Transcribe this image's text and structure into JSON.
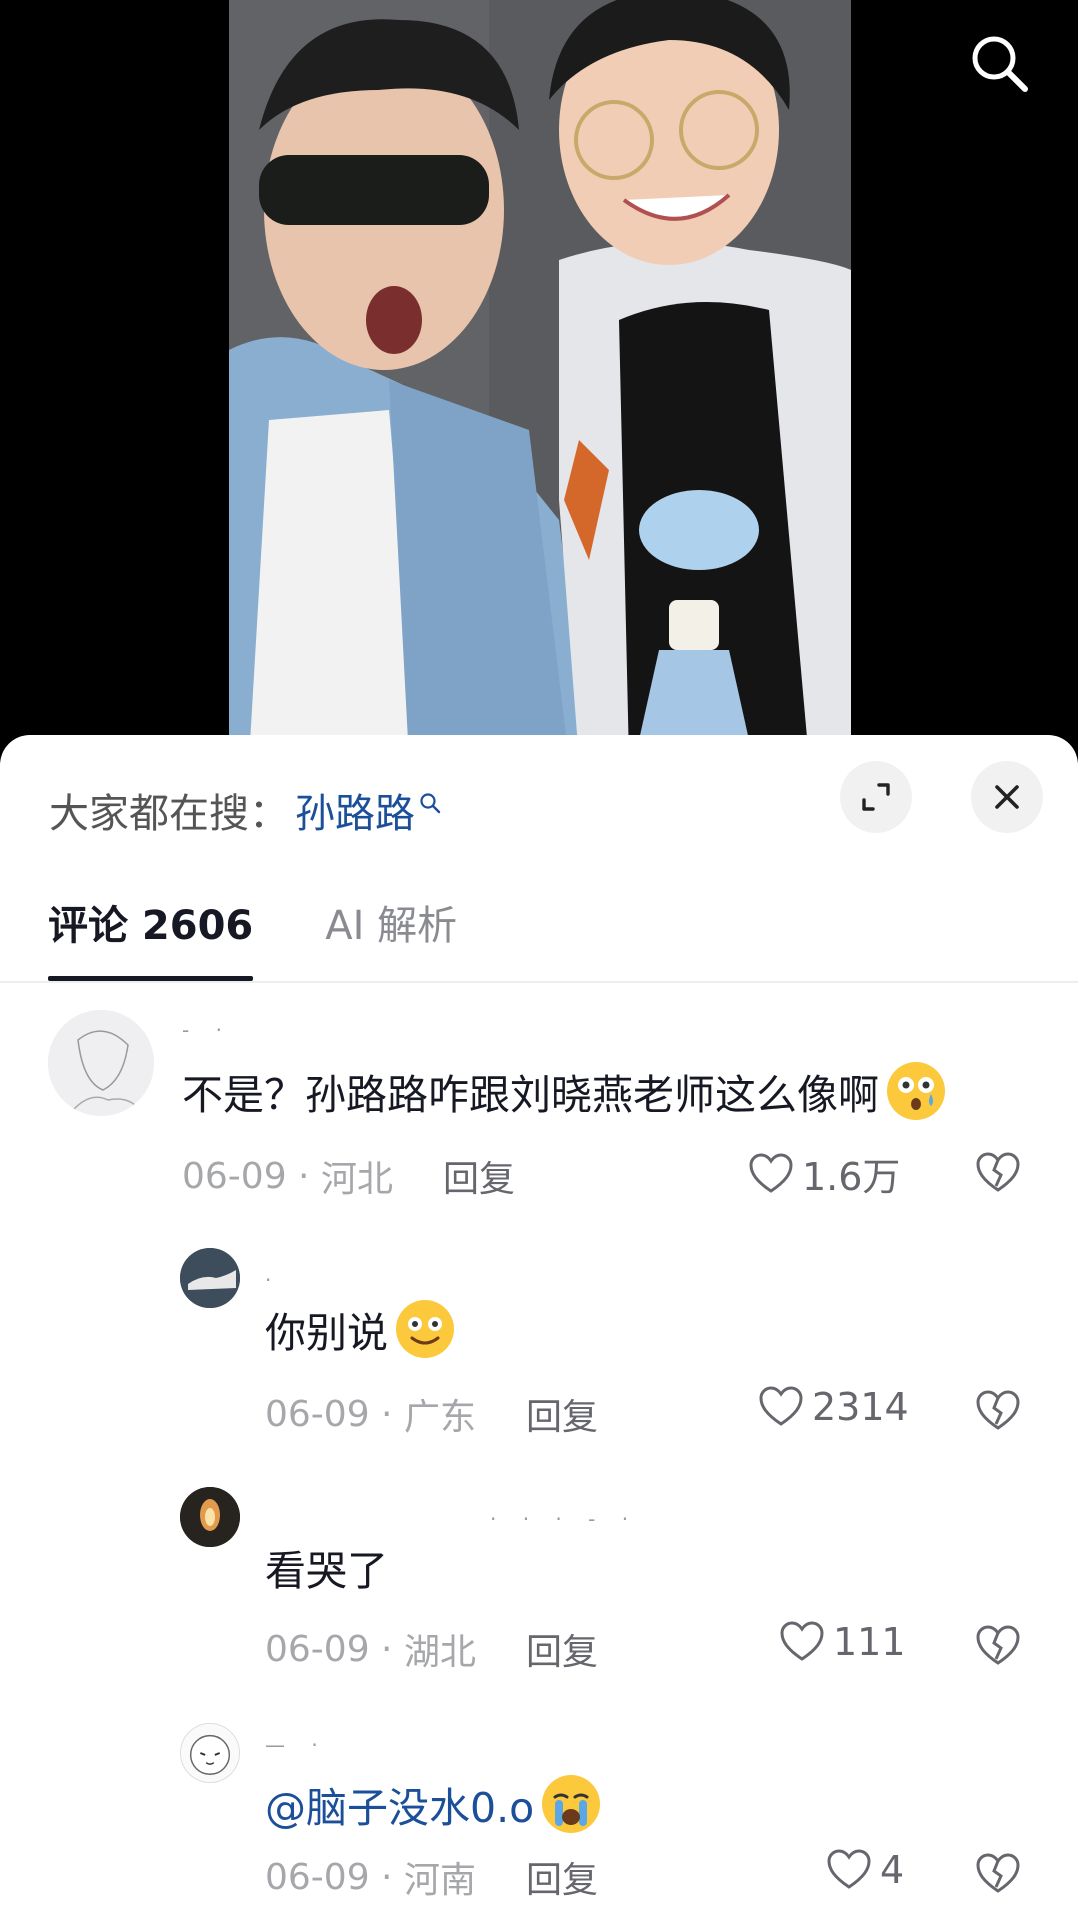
{
  "icons": {
    "search": "search-icon",
    "expand": "expand-icon",
    "close": "close-icon",
    "like": "heart-icon",
    "dislike": "broken-heart-icon"
  },
  "colors": {
    "accent_link": "#1c4f99",
    "text_primary": "#161823",
    "text_secondary": "#a6a7ab"
  },
  "hot_search": {
    "label": "大家都在搜：",
    "term": "孙路路"
  },
  "tabs": [
    {
      "label": "评论 2606",
      "active": true
    },
    {
      "label": "AI 解析",
      "active": false
    }
  ],
  "comments": [
    {
      "text": "不是？孙路路咋跟刘晓燕老师这么像啊",
      "emoji": "astonished-tear-emoji",
      "date": "06-09",
      "location": "河北",
      "reply_label": "回复",
      "likes": "1.6万"
    },
    {
      "text": "你别说",
      "emoji": "smile-emoji",
      "date": "06-09",
      "location": "广东",
      "reply_label": "回复",
      "likes": "2314"
    },
    {
      "text": "看哭了",
      "date": "06-09",
      "location": "湖北",
      "reply_label": "回复",
      "likes": "111"
    },
    {
      "mention": "@脑子没水0.o",
      "emoji": "crying-emoji",
      "date": "06-09",
      "location": "河南",
      "reply_label": "回复",
      "likes": "4"
    }
  ]
}
